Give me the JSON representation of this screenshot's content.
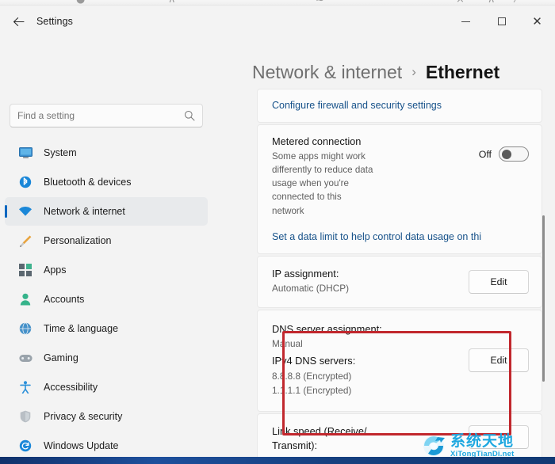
{
  "window": {
    "app_title": "Settings",
    "back_icon": "back-arrow-icon",
    "controls": {
      "minimize": "minimize-icon",
      "maximize": "maximize-icon",
      "close": "close-icon"
    }
  },
  "header": {
    "breadcrumb_parent": "Network & internet",
    "breadcrumb_separator": "›",
    "breadcrumb_current": "Ethernet"
  },
  "search": {
    "placeholder": "Find a setting",
    "value": "",
    "icon": "search-icon"
  },
  "sidebar": {
    "items": [
      {
        "label": "System",
        "icon": "monitor-icon",
        "selected": false
      },
      {
        "label": "Bluetooth & devices",
        "icon": "bluetooth-icon",
        "selected": false
      },
      {
        "label": "Network & internet",
        "icon": "wifi-icon",
        "selected": true
      },
      {
        "label": "Personalization",
        "icon": "paintbrush-icon",
        "selected": false
      },
      {
        "label": "Apps",
        "icon": "apps-grid-icon",
        "selected": false
      },
      {
        "label": "Accounts",
        "icon": "person-icon",
        "selected": false
      },
      {
        "label": "Time & language",
        "icon": "globe-clock-icon",
        "selected": false
      },
      {
        "label": "Gaming",
        "icon": "gamepad-icon",
        "selected": false
      },
      {
        "label": "Accessibility",
        "icon": "accessibility-icon",
        "selected": false
      },
      {
        "label": "Privacy & security",
        "icon": "shield-icon",
        "selected": false
      },
      {
        "label": "Windows Update",
        "icon": "update-icon",
        "selected": false
      }
    ]
  },
  "content": {
    "firewall_link": "Configure firewall and security settings",
    "metered": {
      "title": "Metered connection",
      "description": "Some apps might work differently to reduce data usage when you're connected to this network",
      "toggle_state_label": "Off",
      "toggle_on": false
    },
    "data_limit_link": "Set a data limit to help control data usage on thi",
    "ip_assignment": {
      "title": "IP assignment:",
      "value": "Automatic (DHCP)",
      "button": "Edit"
    },
    "dns": {
      "title": "DNS server assignment:",
      "assignment_value": "Manual",
      "servers_title": "IPv4 DNS servers:",
      "server_1": "8.8.8.8 (Encrypted)",
      "server_2": "1.1.1.1 (Encrypted)",
      "button": "Edit",
      "highlight_color": "#c1272d"
    },
    "link_speed": {
      "title_line1": "Link speed (Receive/",
      "title_line2": "Transmit):"
    }
  },
  "watermark": {
    "chinese": "系统天地",
    "domain": "XiTongTianDi.net",
    "color": "#1fa8e0"
  }
}
